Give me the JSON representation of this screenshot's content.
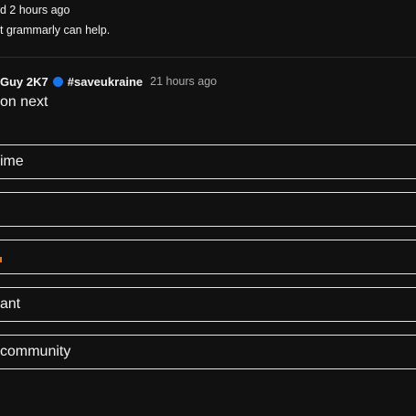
{
  "previous_comment": {
    "meta": "d 2 hours ago",
    "text": "t grammarly can help."
  },
  "comment": {
    "author": "Guy 2K7",
    "badge_color": "#1a73e8",
    "tag": "#saveukraine",
    "time": "21 hours ago",
    "text": "on next"
  },
  "options": [
    {
      "label": "ime"
    },
    {
      "label": ""
    },
    {
      "label": ""
    },
    {
      "label": "ant"
    },
    {
      "label": "community"
    }
  ],
  "accent_color": "#e8761a"
}
